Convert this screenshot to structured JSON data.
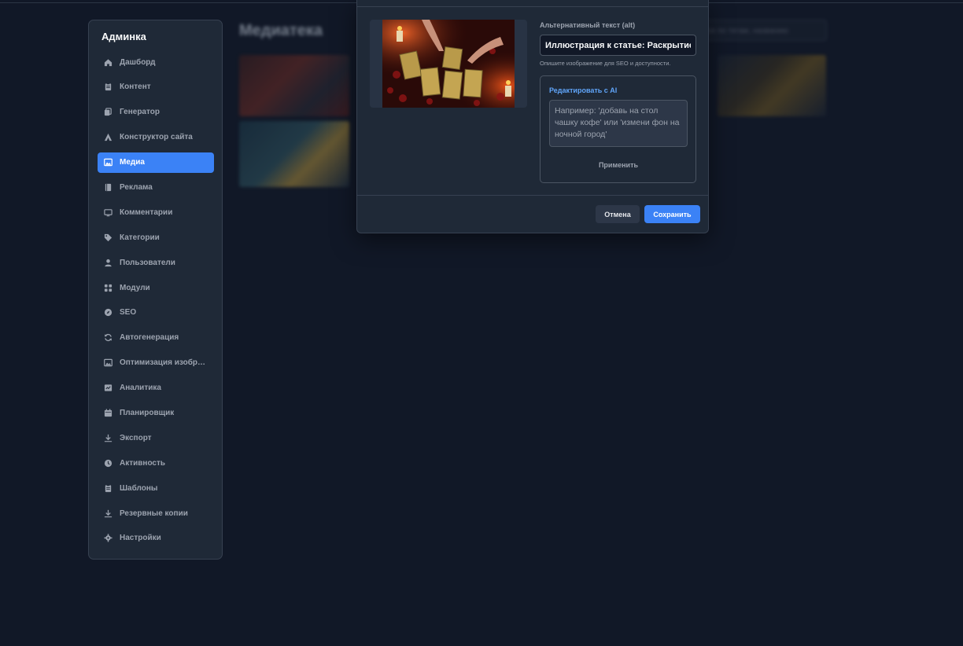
{
  "sidebar": {
    "title": "Админка",
    "items": [
      {
        "label": "Дашборд",
        "icon": "home-icon"
      },
      {
        "label": "Контент",
        "icon": "clipboard-icon"
      },
      {
        "label": "Генератор",
        "icon": "copy-icon"
      },
      {
        "label": "Конструктор сайта",
        "icon": "triangle-icon"
      },
      {
        "label": "Медиа",
        "icon": "image-icon",
        "active": true
      },
      {
        "label": "Реклама",
        "icon": "book-icon"
      },
      {
        "label": "Комментарии",
        "icon": "monitor-icon"
      },
      {
        "label": "Категории",
        "icon": "tag-icon"
      },
      {
        "label": "Пользователи",
        "icon": "user-icon"
      },
      {
        "label": "Модули",
        "icon": "grid-icon"
      },
      {
        "label": "SEO",
        "icon": "compass-icon"
      },
      {
        "label": "Автогенерация",
        "icon": "refresh-icon"
      },
      {
        "label": "Оптимизация изображений",
        "icon": "image-icon"
      },
      {
        "label": "Аналитика",
        "icon": "chart-icon"
      },
      {
        "label": "Планировщик",
        "icon": "calendar-icon"
      },
      {
        "label": "Экспорт",
        "icon": "download-icon"
      },
      {
        "label": "Активность",
        "icon": "clock-icon"
      },
      {
        "label": "Шаблоны",
        "icon": "clipboard-icon"
      },
      {
        "label": "Резервные копии",
        "icon": "download-icon"
      },
      {
        "label": "Настройки",
        "icon": "gear-icon"
      }
    ]
  },
  "background": {
    "title": "Медиатека",
    "search_placeholder": "иск по тегам, названию"
  },
  "modal": {
    "alt_label": "Альтернативный текст (alt)",
    "alt_value": "Иллюстрация к статье: Раскрытие Т",
    "alt_help": "Опишите изображение для SEO и доступности.",
    "ai_title": "Редактировать с AI",
    "ai_placeholder": "Например: 'добавь на стол чашку кофе' или 'измени фон на ночной город'",
    "ai_apply": "Применить",
    "cancel": "Отмена",
    "save": "Сохранить"
  },
  "colors": {
    "background": "#111827",
    "panel": "#1f2937",
    "accent": "#3b82f6",
    "ai_title": "#60a5fa"
  }
}
